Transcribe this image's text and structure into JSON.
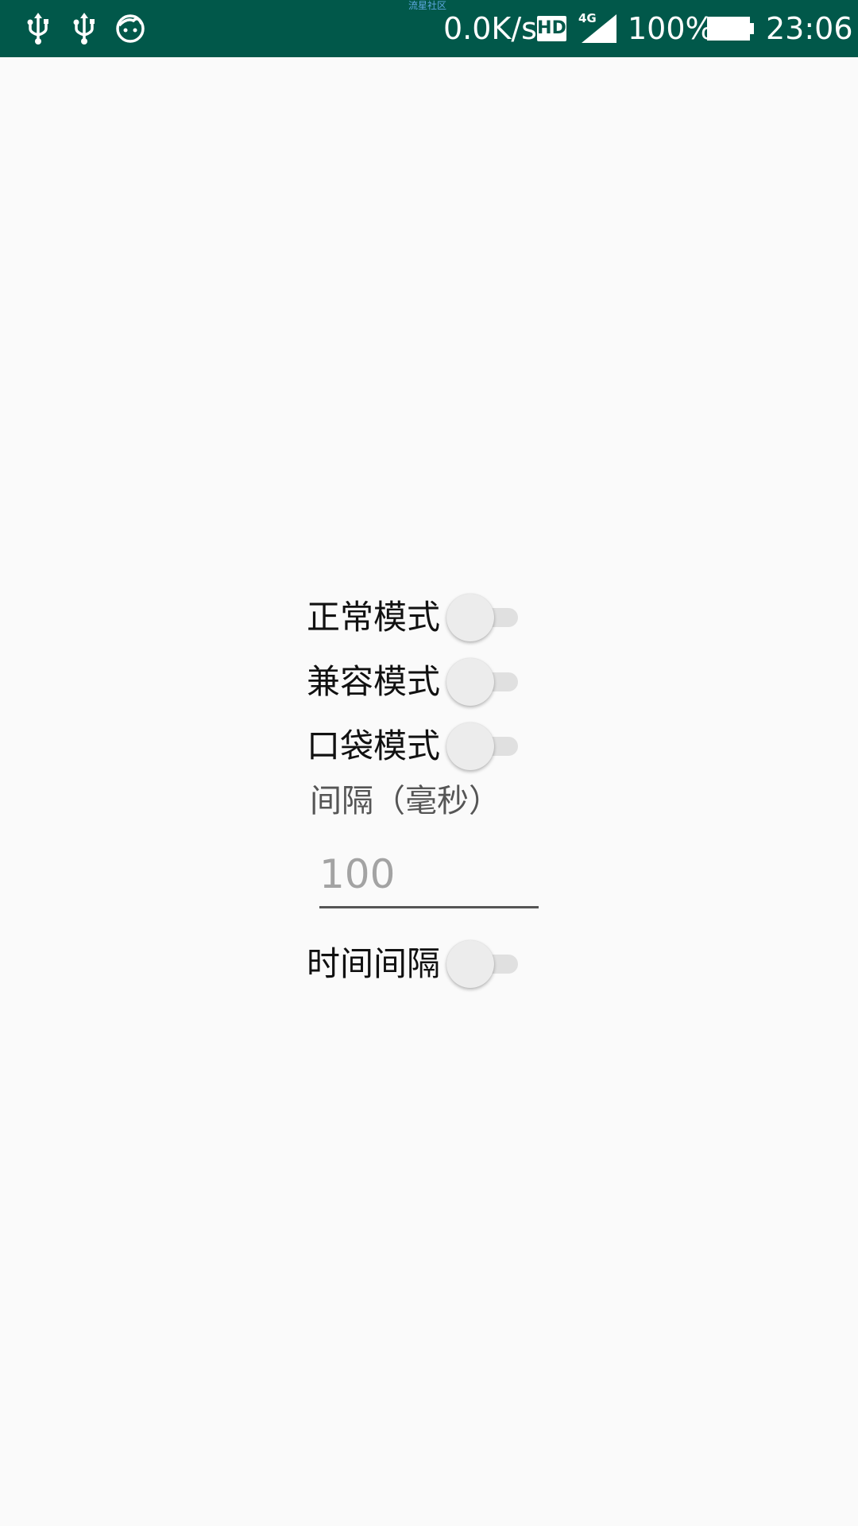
{
  "status_bar": {
    "watermark": "流星社区",
    "net_speed": "0.0K/s",
    "hd_badge": "HD",
    "network_type": "4G",
    "battery_percent": "100%",
    "time": "23:06",
    "left_icons": [
      "usb-icon",
      "usb-icon",
      "face-icon"
    ],
    "background": "#01584a"
  },
  "settings": {
    "normal_mode": {
      "label": "正常模式",
      "enabled": false
    },
    "compat_mode": {
      "label": "兼容模式",
      "enabled": false
    },
    "pocket_mode": {
      "label": "口袋模式",
      "enabled": false
    },
    "interval": {
      "label": "间隔（毫秒）",
      "placeholder": "100",
      "value": ""
    },
    "time_interval": {
      "label": "时间间隔",
      "enabled": false
    }
  }
}
